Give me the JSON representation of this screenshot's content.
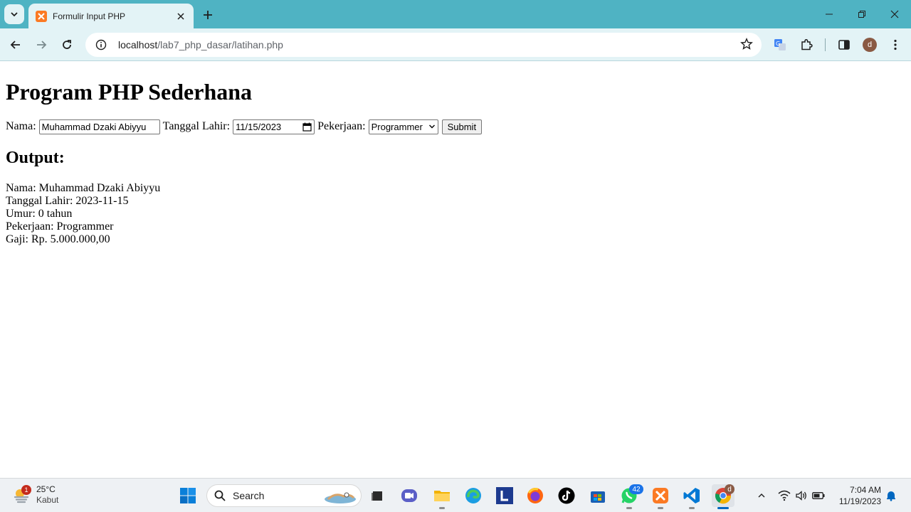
{
  "browser": {
    "tab_title": "Formulir Input PHP",
    "url_host": "localhost",
    "url_path": "/lab7_php_dasar/latihan.php",
    "profile_initial": "d",
    "accent": "#4fb3c3"
  },
  "page": {
    "heading": "Program PHP Sederhana",
    "form": {
      "nama_label": "Nama:",
      "nama_value": "Muhammad Dzaki Abiyyu",
      "tanggal_label": "Tanggal Lahir:",
      "tanggal_value": "11/15/2023",
      "pekerjaan_label": "Pekerjaan:",
      "pekerjaan_value": "Programmer",
      "submit_label": "Submit"
    },
    "output_heading": "Output:",
    "output_lines": [
      "Nama: Muhammad Dzaki Abiyyu",
      "Tanggal Lahir: 2023-11-15",
      "Umur: 0 tahun",
      "Pekerjaan: Programmer",
      "Gaji: Rp. 5.000.000,00"
    ]
  },
  "taskbar": {
    "weather_temp": "25°C",
    "weather_condition": "Kabut",
    "weather_badge": "1",
    "search_label": "Search",
    "whatsapp_badge": "42",
    "chrome_badge": "d",
    "time": "7:04 AM",
    "date": "11/19/2023"
  }
}
